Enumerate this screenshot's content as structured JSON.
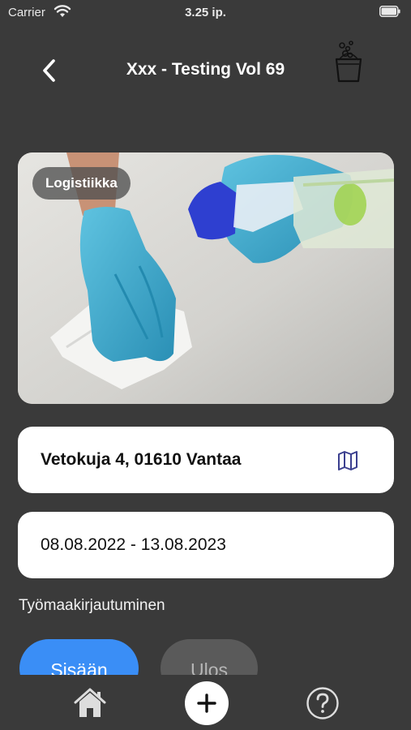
{
  "status_bar": {
    "carrier": "Carrier",
    "time": "3.25 ip.",
    "icons": [
      "wifi-icon",
      "battery-icon"
    ]
  },
  "header": {
    "title": "Xxx - Testing Vol 69",
    "back_icon": "chevron-left-icon",
    "action_icon": "cleaning-bucket-icon"
  },
  "hero": {
    "category": "Logistiikka",
    "image_subject": "gloved hands cleaning a surface with spray bottle"
  },
  "address": {
    "text": "Vetokuja 4, 01610 Vantaa",
    "icon": "map-icon"
  },
  "dates": {
    "text": "08.08.2022 - 13.08.2023"
  },
  "site_login": {
    "label": "Työmaakirjautuminen",
    "sign_in_label": "Sisään",
    "sign_out_label": "Ulos"
  },
  "tab_bar": {
    "icons": [
      "home-icon",
      "plus-icon",
      "question-circle-icon"
    ]
  },
  "colors": {
    "background": "#3a3a3a",
    "card": "#ffffff",
    "primary": "#3a8ef6",
    "secondary_button": "#5a5a5a",
    "map_icon": "#3b3f8f"
  }
}
